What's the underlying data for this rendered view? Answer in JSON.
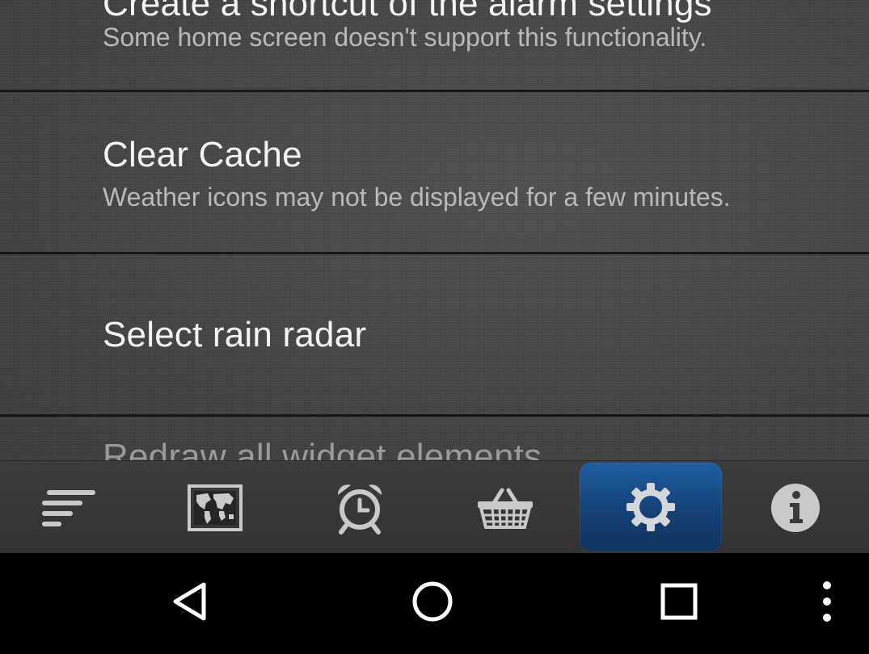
{
  "settings": {
    "items": [
      {
        "title": "Create a shortcut of the alarm settings",
        "summary": "Some home screen doesn't support this functionality."
      },
      {
        "title": "Clear Cache",
        "summary": "Weather icons may not be displayed for a few minutes."
      },
      {
        "title": "Select rain radar",
        "summary": ""
      },
      {
        "title": "Redraw all widget elements",
        "summary": ""
      }
    ]
  },
  "tab_bar": {
    "tabs": [
      {
        "icon": "menu-lines-icon",
        "selected": false
      },
      {
        "icon": "world-map-icon",
        "selected": false
      },
      {
        "icon": "alarm-clock-icon",
        "selected": false
      },
      {
        "icon": "shopping-basket-icon",
        "selected": false
      },
      {
        "icon": "gear-icon",
        "selected": true
      },
      {
        "icon": "info-icon",
        "selected": false
      }
    ],
    "active_color": "#1a4f8c"
  },
  "nav_bar": {
    "buttons": [
      "back-icon",
      "home-icon",
      "recents-icon",
      "overflow-menu-icon"
    ]
  }
}
